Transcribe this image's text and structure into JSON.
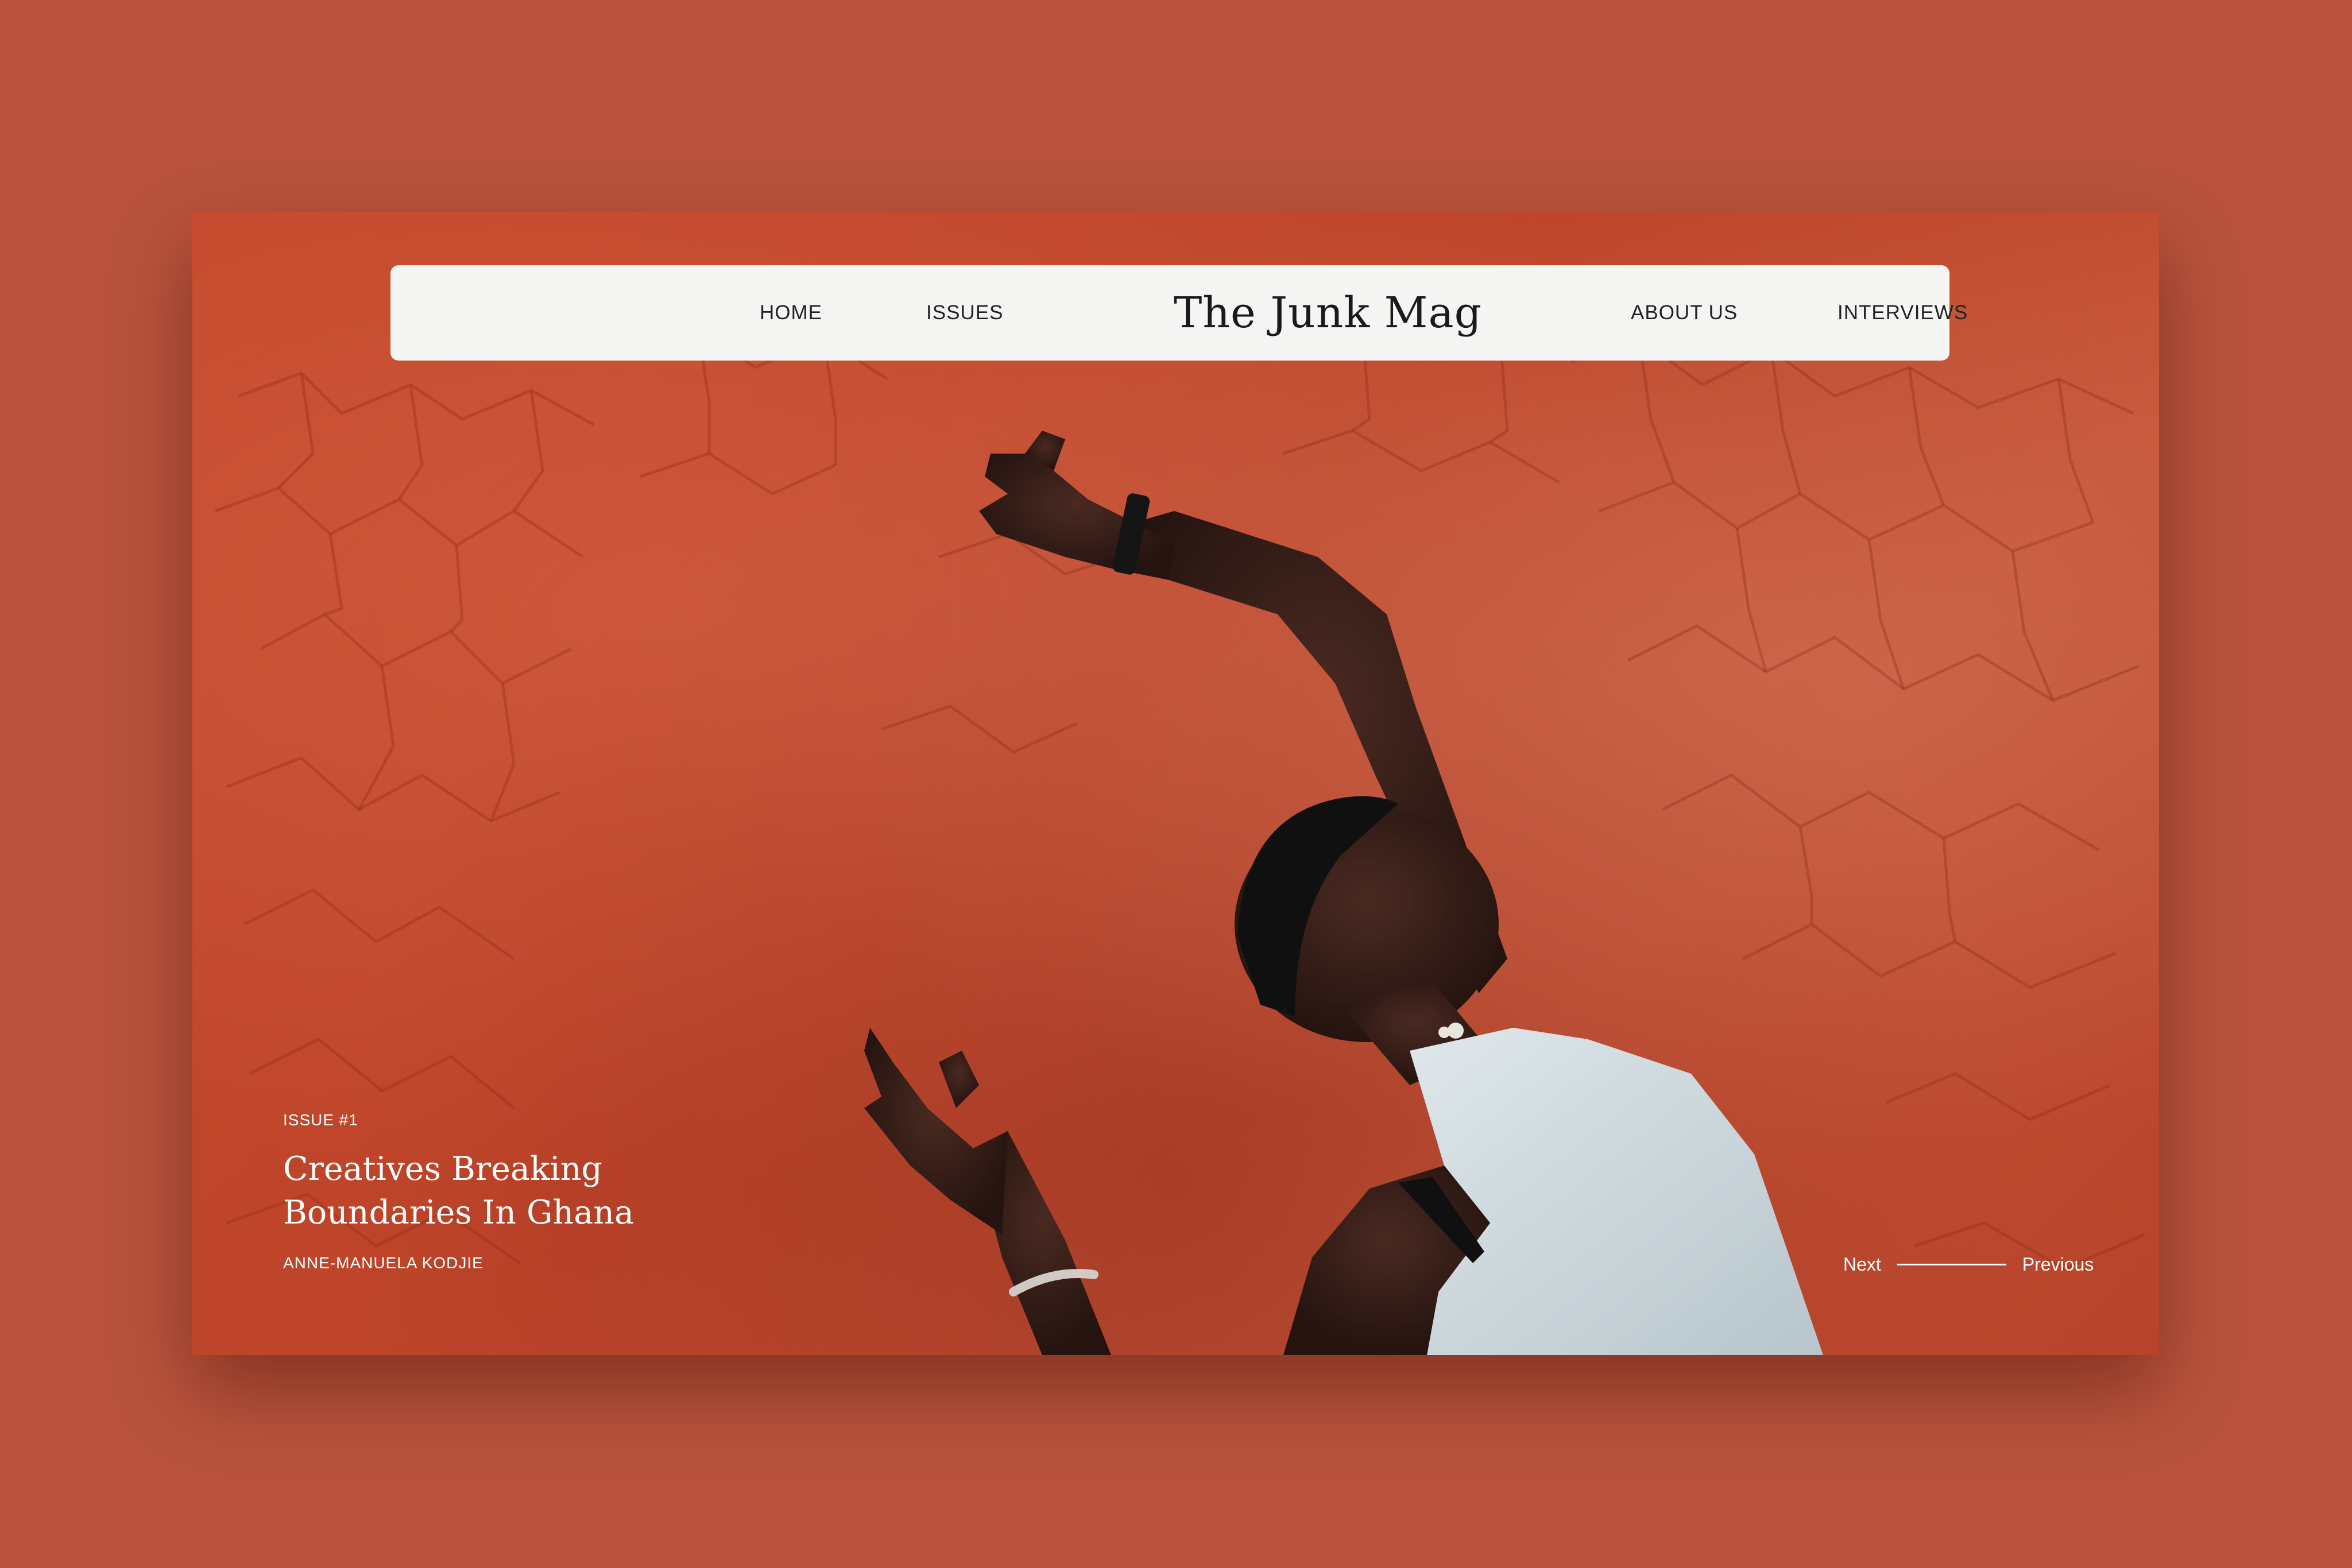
{
  "brand": {
    "name": "The Junk Mag"
  },
  "nav": {
    "left": [
      {
        "label": "HOME"
      },
      {
        "label": "ISSUES"
      }
    ],
    "right": [
      {
        "label": "ABOUT US"
      },
      {
        "label": "INTERVIEWS"
      }
    ]
  },
  "hero": {
    "issue": "ISSUE #1",
    "headline_line1": "Creatives Breaking",
    "headline_line2": "Boundaries In Ghana",
    "author": "ANNE-MANUELA KODJIE",
    "image": "photo-woman-dancing-against-cracked-red-wall"
  },
  "pager": {
    "next_label": "Next",
    "previous_label": "Previous"
  },
  "colors": {
    "page_background": "#b9533d",
    "wall": "#c0482c",
    "navbar_background": "#f5f5f4",
    "text_dark": "#1a1a1a",
    "text_light": "#ffffff"
  }
}
